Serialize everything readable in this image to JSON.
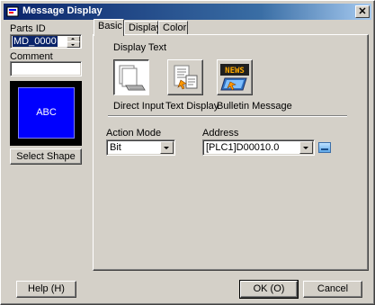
{
  "window": {
    "title": "Message Display",
    "close_glyph": "✕"
  },
  "left": {
    "parts_id_label": "Parts ID",
    "parts_id_value": "MD_0000",
    "comment_label": "Comment",
    "comment_value": "",
    "preview_text": "ABC",
    "preview_color": "#0000ff",
    "select_shape_label": "Select Shape"
  },
  "tabs": [
    {
      "label": "Basic",
      "active": true
    },
    {
      "label": "Display",
      "active": false
    },
    {
      "label": "Color",
      "active": false
    }
  ],
  "basic": {
    "display_text_label": "Display Text",
    "options": [
      {
        "label": "Direct Input",
        "icon": "direct-input-icon",
        "selected": true
      },
      {
        "label": "Text Display",
        "icon": "text-display-icon",
        "selected": false
      },
      {
        "label": "Bulletin Message",
        "icon": "news-bulletin-icon",
        "selected": false
      }
    ],
    "action_mode_label": "Action Mode",
    "action_mode_value": "Bit",
    "address_label": "Address",
    "address_value": "[PLC1]D00010.0"
  },
  "footer": {
    "help_label": "Help (H)",
    "ok_label": "OK (O)",
    "cancel_label": "Cancel"
  }
}
